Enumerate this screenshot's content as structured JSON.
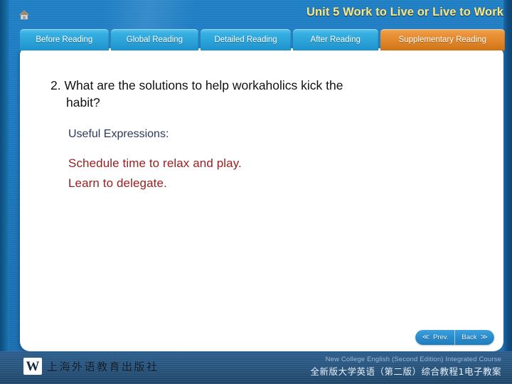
{
  "header": {
    "home_icon": "home-icon",
    "unit_title": "Unit 5  Work to Live or Live to Work"
  },
  "tabs": [
    {
      "label": "Before Reading",
      "active": false
    },
    {
      "label": "Global Reading",
      "active": false
    },
    {
      "label": "Detailed Reading",
      "active": false
    },
    {
      "label": "After Reading",
      "active": false
    },
    {
      "label": "Supplementary Reading",
      "active": true
    }
  ],
  "content": {
    "question_number": "2.",
    "question_line1": "What are the solutions to help workaholics kick the",
    "question_line2": "habit?",
    "useful_label": "Useful Expressions:",
    "expressions": [
      "Schedule time to relax and play.",
      "Learn to delegate."
    ]
  },
  "nav": {
    "prev_label": "Prev.",
    "prev_icon": "chevron-double-left-icon",
    "back_label": "Back",
    "back_icon": "chevron-double-right-icon",
    "prev_chevron": "≪",
    "back_chevron": "≫"
  },
  "footer": {
    "logo_mark": "W",
    "publisher_cn": "上海外语教育出版社",
    "course_en": "New College English (Second Edition) Integrated Course",
    "course_cn": "全新版大学英语（第二版）综合教程1电子教案"
  },
  "colors": {
    "accent_orange": "#e1852a",
    "tab_blue": "#2ba2d8",
    "title_yellow": "#f7e98a",
    "expression_red": "#99201f",
    "label_navy": "#2b3a5c",
    "footer_blue": "#28567f",
    "background_blue": "#1b72b6"
  }
}
